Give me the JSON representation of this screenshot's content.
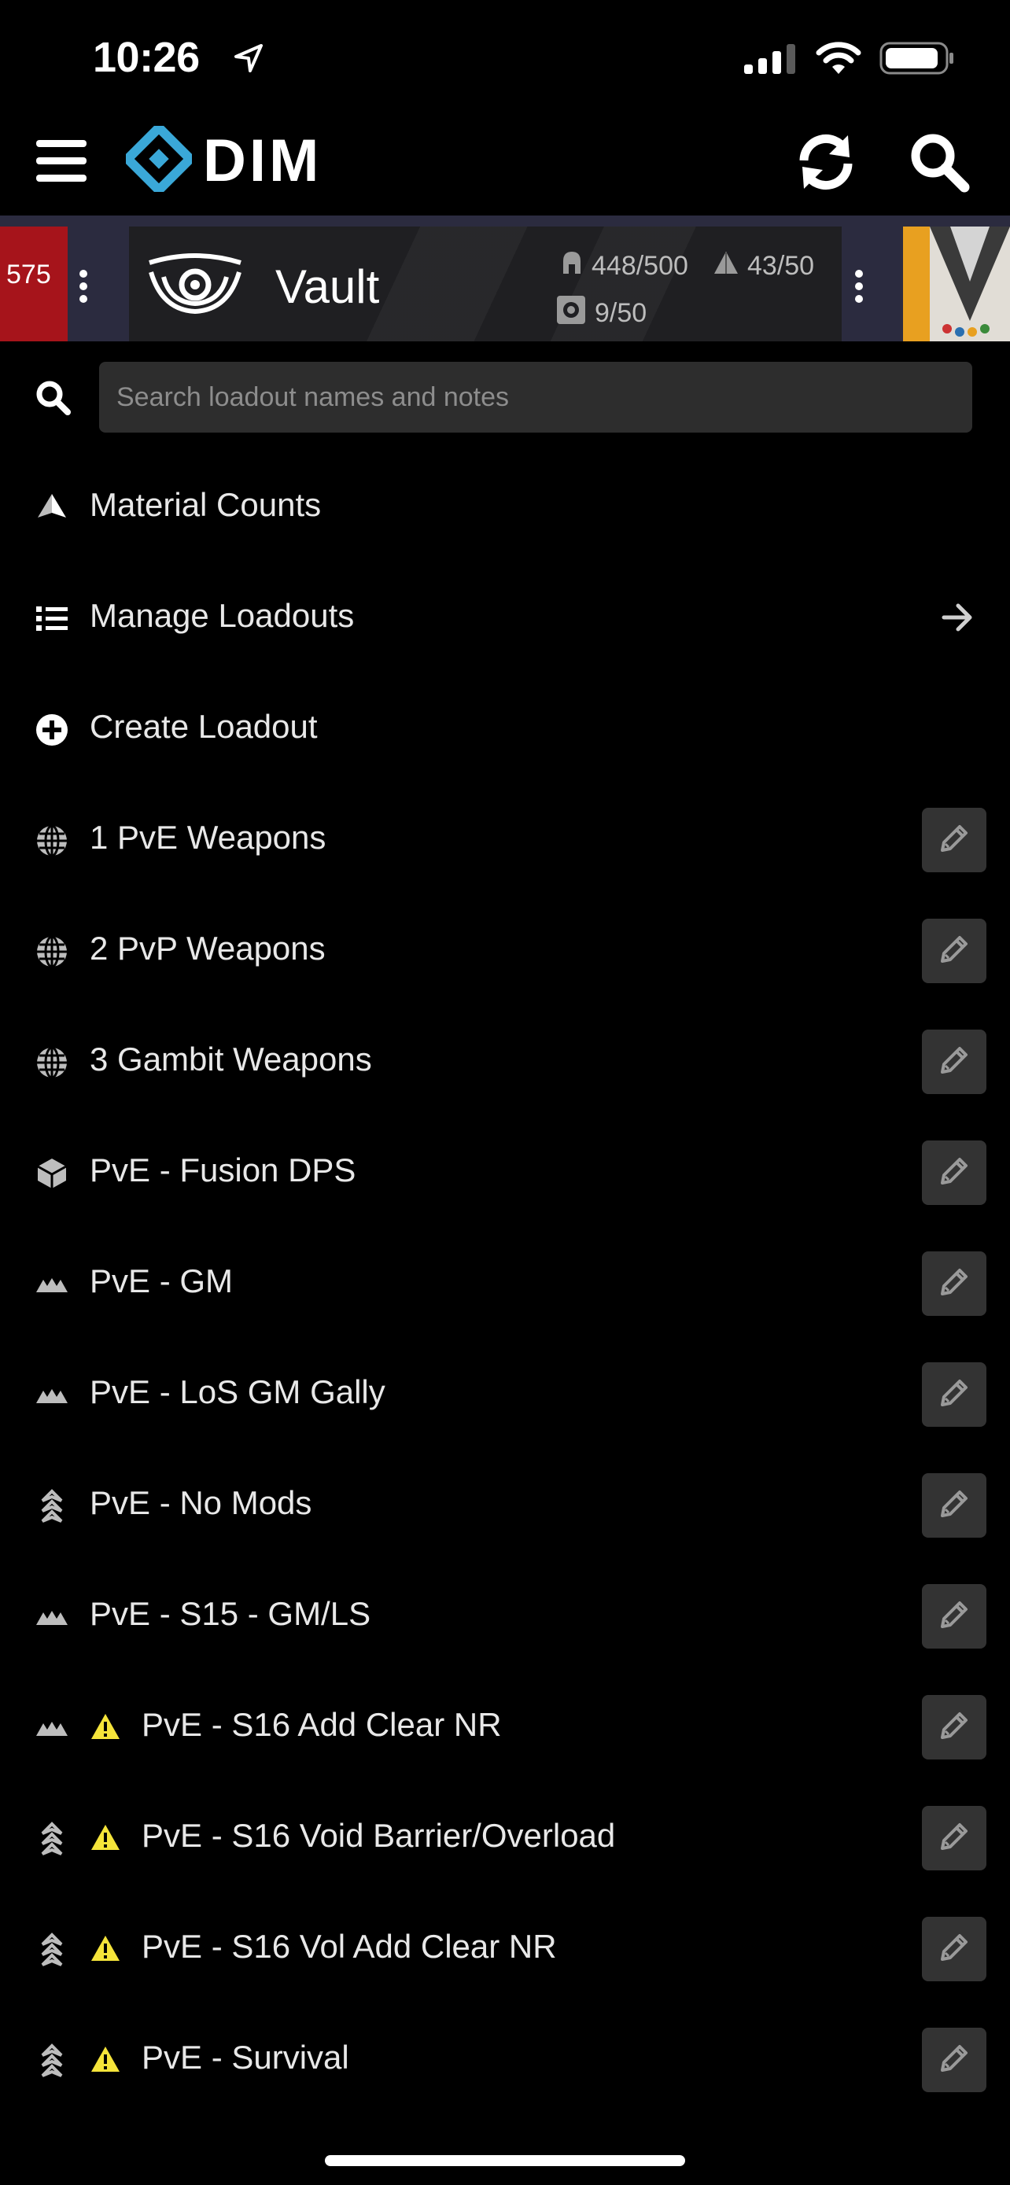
{
  "status_bar": {
    "time": "10:26"
  },
  "app": {
    "logo_text": "DIM"
  },
  "characters": {
    "left_power": "575",
    "vault": {
      "title": "Vault",
      "armor": "448/500",
      "materials": "43/50",
      "mods": "9/50"
    }
  },
  "search": {
    "placeholder": "Search loadout names and notes"
  },
  "menu": {
    "material_counts": "Material Counts",
    "manage_loadouts": "Manage Loadouts",
    "create_loadout": "Create Loadout"
  },
  "loadouts": [
    {
      "name": "1 PvE Weapons",
      "icon": "globe-icon",
      "warning": false
    },
    {
      "name": "2 PvP Weapons",
      "icon": "globe-icon",
      "warning": false
    },
    {
      "name": "3 Gambit Weapons",
      "icon": "globe-icon",
      "warning": false
    },
    {
      "name": "PvE - Fusion DPS",
      "icon": "cube-icon",
      "warning": false
    },
    {
      "name": "PvE - GM",
      "icon": "mountain-icon",
      "warning": false
    },
    {
      "name": "PvE - LoS GM Gally",
      "icon": "mountain-icon",
      "warning": false
    },
    {
      "name": "PvE - No Mods",
      "icon": "hunter-icon",
      "warning": false
    },
    {
      "name": "PvE - S15 - GM/LS",
      "icon": "mountain-icon",
      "warning": false
    },
    {
      "name": "PvE - S16 Add Clear NR",
      "icon": "mountain-icon",
      "warning": true
    },
    {
      "name": "PvE - S16 Void Barrier/Overload",
      "icon": "hunter-icon",
      "warning": true
    },
    {
      "name": "PvE - S16 Vol Add Clear NR",
      "icon": "hunter-icon",
      "warning": true
    },
    {
      "name": "PvE - Survival",
      "icon": "hunter-icon",
      "warning": true
    }
  ],
  "colors": {
    "accent": "#3aa8d8",
    "warning": "#f5e43a",
    "edit_bg": "#333333",
    "left_char": "#a6141b"
  }
}
